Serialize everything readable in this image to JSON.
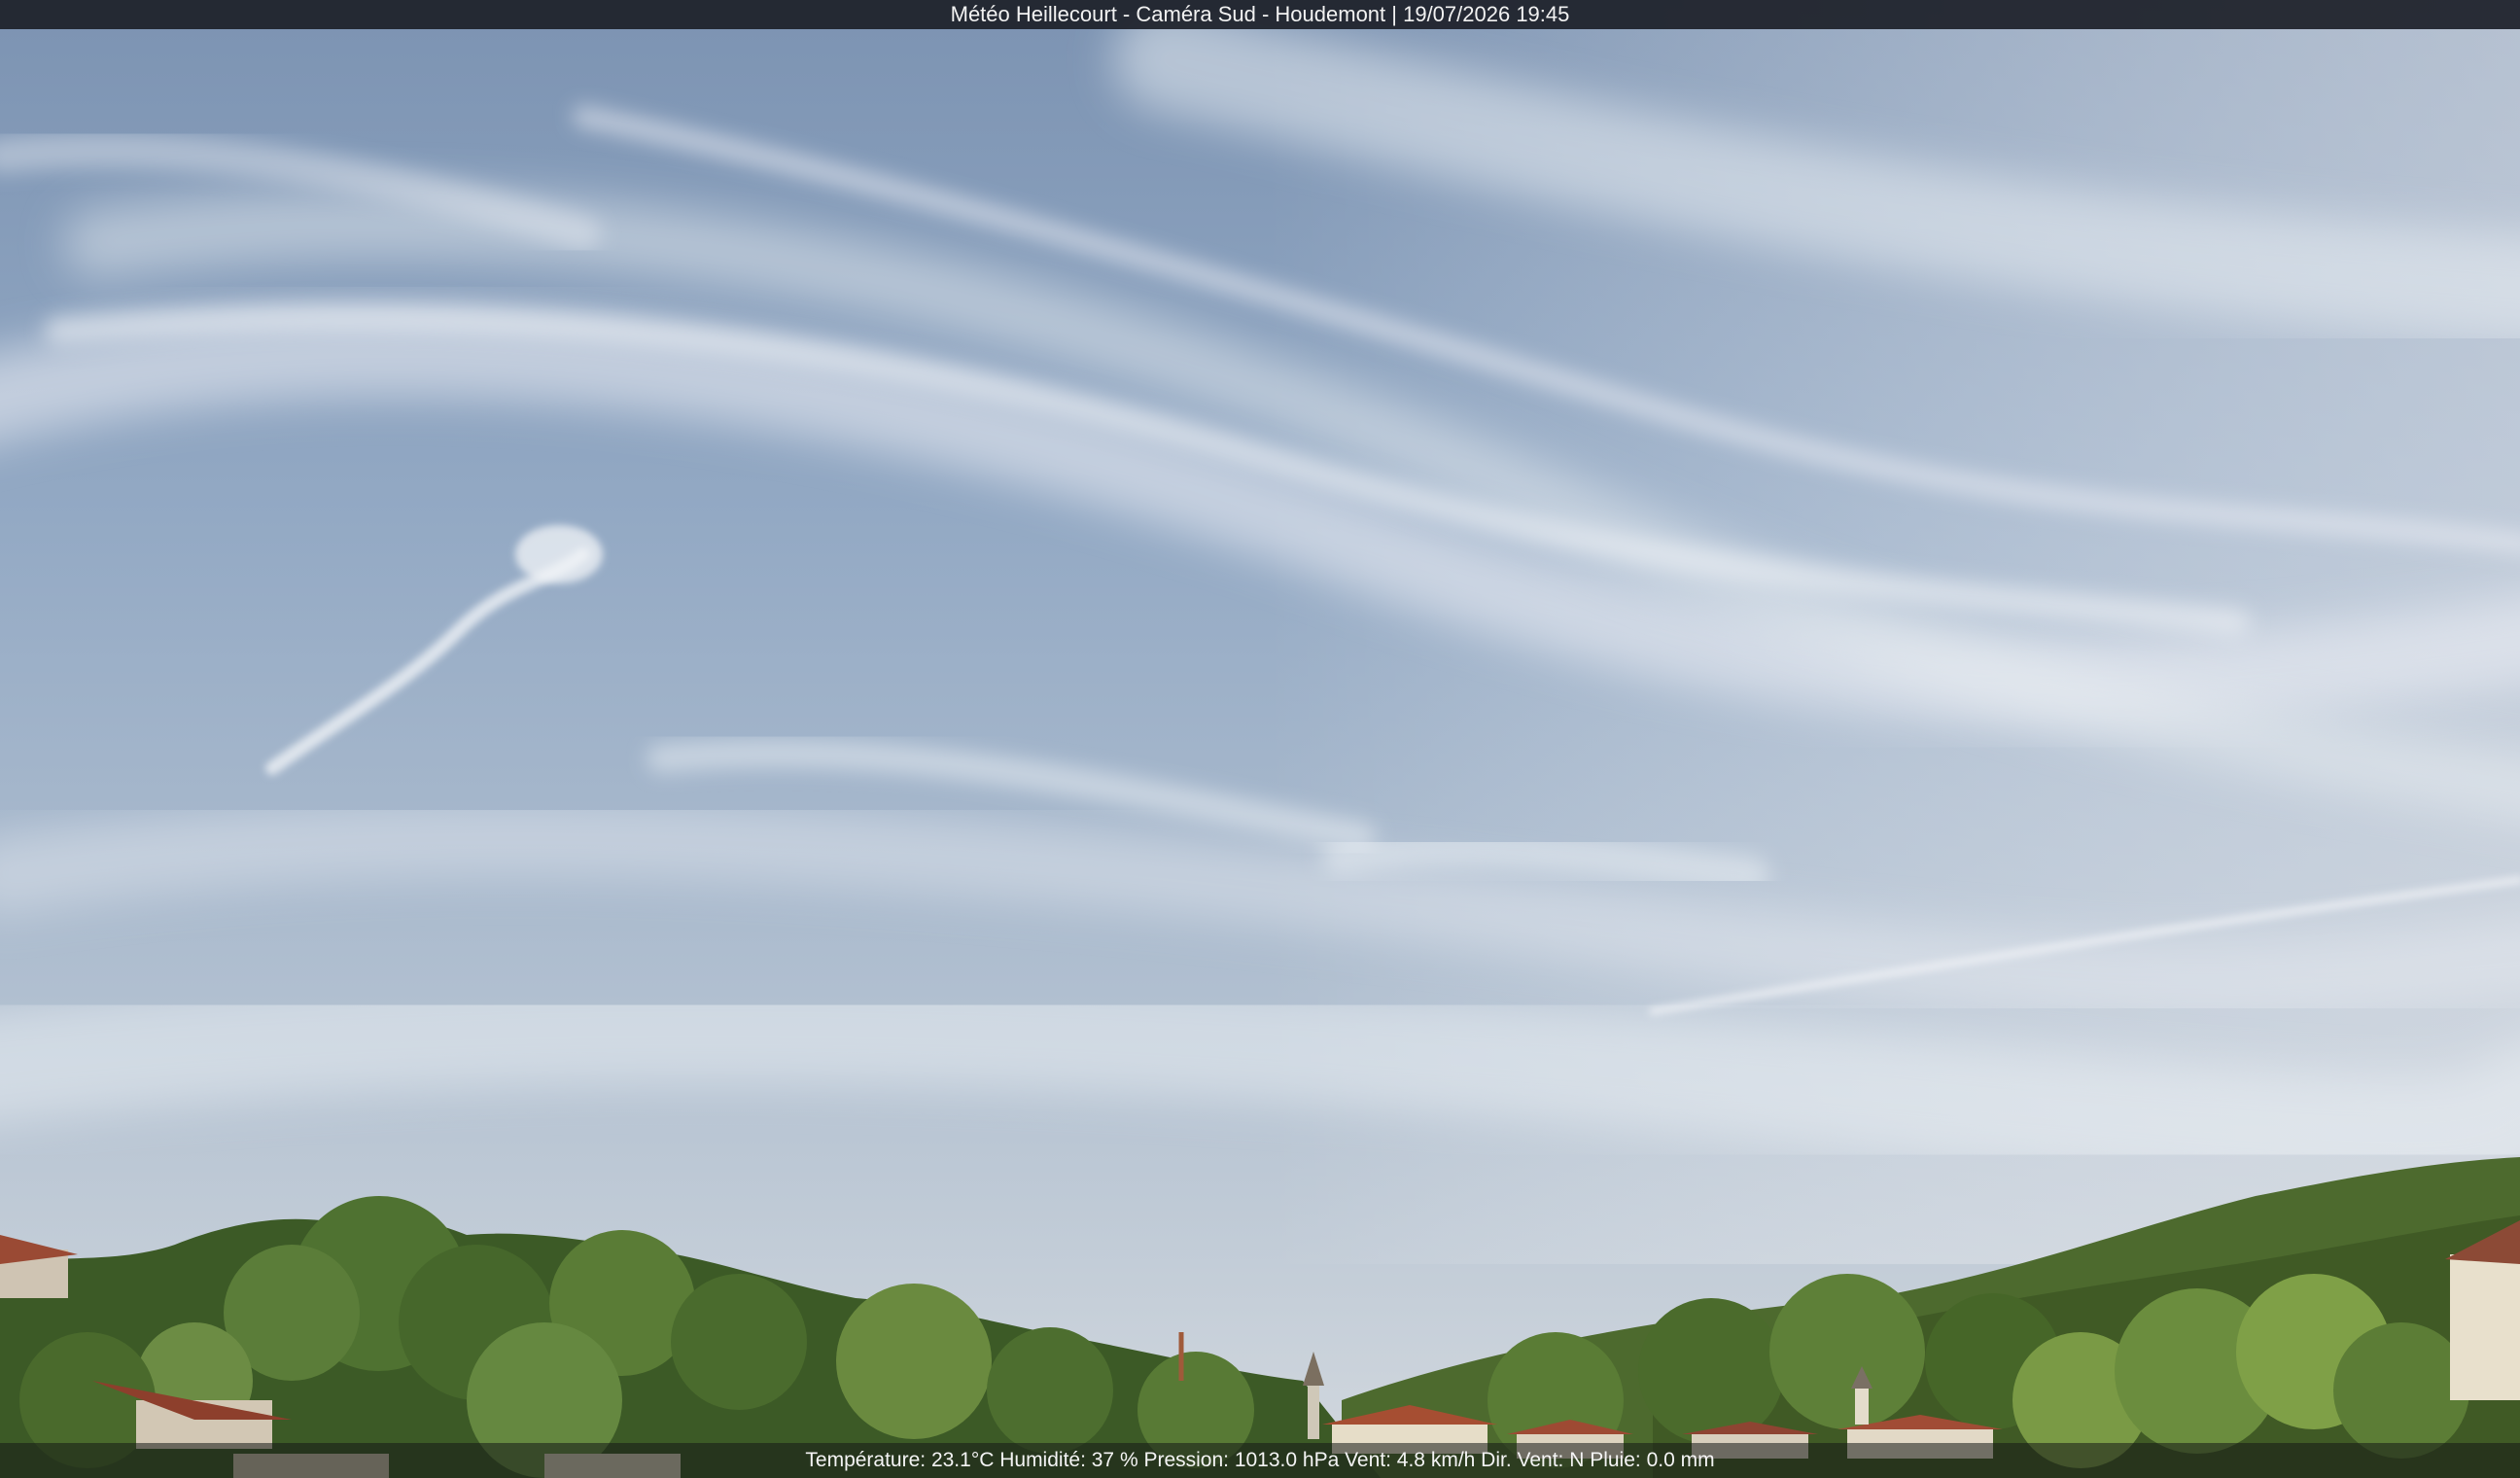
{
  "overlay": {
    "title": "Météo Heillecourt - Caméra Sud - Houdemont | 19/07/2026 19:45",
    "weather_line": "Température: 23.1°C  Humidité: 37 % Pression: 1013.0 hPa Vent: 4.8 km/h Dir. Vent: N Pluie: 0.0 mm"
  },
  "colors": {
    "sky_top": "#7e95b3",
    "sky_mid": "#9cb2ca",
    "sky_horizon": "#c9d2dc",
    "cloud": "#e9edf2",
    "foliage_dark": "#2f4a1f",
    "foliage_light": "#6f8f3c",
    "roof": "#9a4a34",
    "overlay_bg": "#1c2028"
  }
}
